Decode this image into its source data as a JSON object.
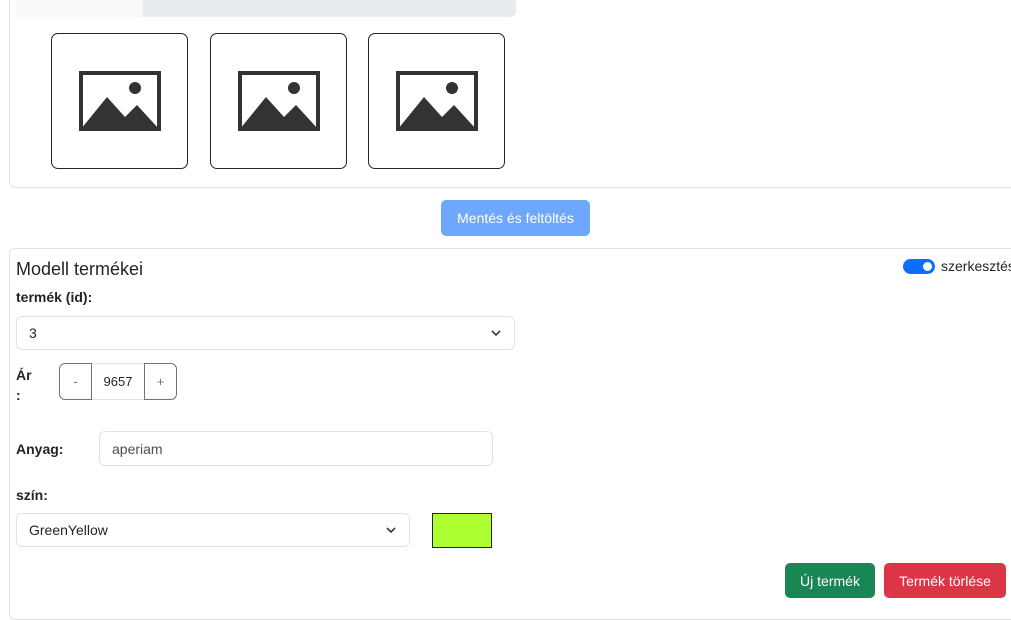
{
  "save_button": {
    "label": "Mentés és feltöltés"
  },
  "products_section": {
    "title": "Modell termékei",
    "edit_toggle": {
      "label": "szerkesztés",
      "on": true
    },
    "product_id": {
      "label": "termék (id):",
      "value": "3"
    },
    "price": {
      "label": "Ár\n:",
      "minus": "-",
      "value": "9657",
      "plus": "+"
    },
    "material": {
      "label": "Anyag:",
      "value": "aperiam"
    },
    "color": {
      "label": "szín:",
      "value": "GreenYellow",
      "swatch_hex": "#adff2f"
    },
    "new_button": {
      "label": "Új termék",
      "color": "#198754"
    },
    "delete_button": {
      "label": "Termék törlése",
      "color": "#dc3545"
    }
  },
  "image_thumbnails": [
    {
      "icon": "image-placeholder-icon"
    },
    {
      "icon": "image-placeholder-icon"
    },
    {
      "icon": "image-placeholder-icon"
    }
  ]
}
